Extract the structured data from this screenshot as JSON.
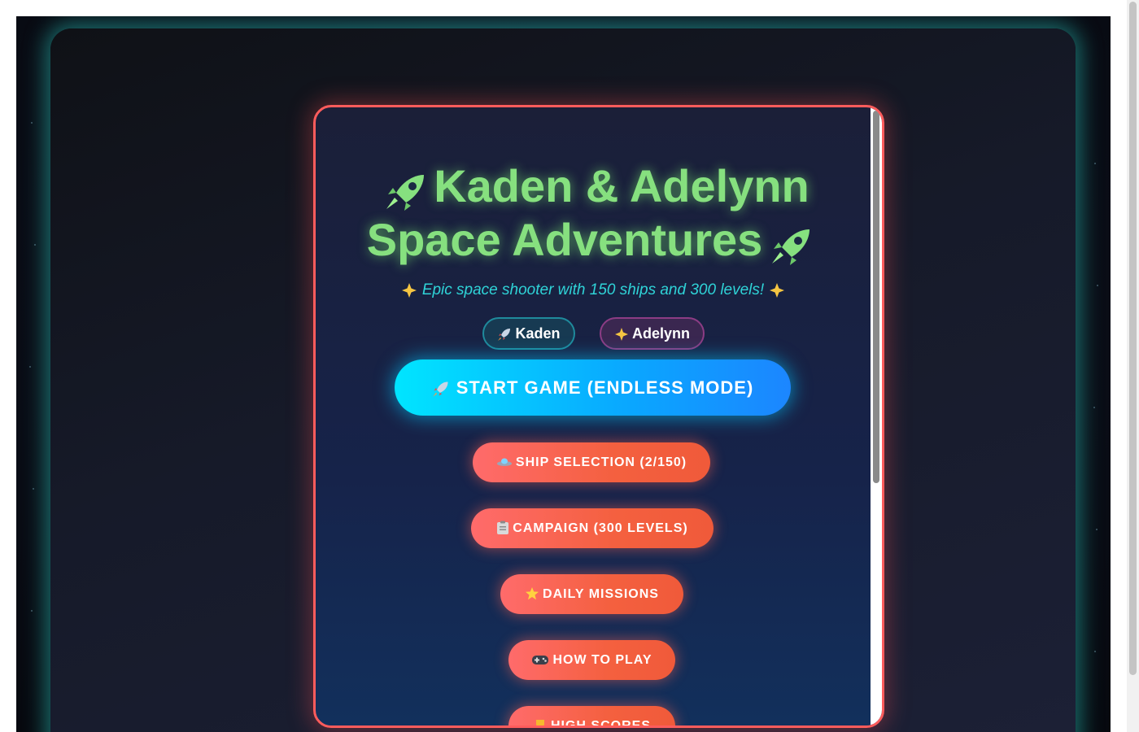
{
  "menu": {
    "title_line1": "Kaden & Adelynn",
    "title_line2": "Space Adventures",
    "subtitle": "Epic space shooter with 150 ships and 300 levels!",
    "players": [
      {
        "label": "Kaden",
        "icon": "rocket-icon"
      },
      {
        "label": "Adelynn",
        "icon": "sparkle-star-icon"
      }
    ],
    "start_button": "START GAME (ENDLESS MODE)",
    "buttons": [
      {
        "label": "SHIP SELECTION (2/150)",
        "icon": "ufo-icon"
      },
      {
        "label": "CAMPAIGN (300 LEVELS)",
        "icon": "clipboard-icon"
      },
      {
        "label": "DAILY MISSIONS",
        "icon": "star-icon"
      },
      {
        "label": "HOW TO PLAY",
        "icon": "gamepad-icon"
      },
      {
        "label": "HIGH SCORES",
        "icon": "trophy-icon"
      }
    ]
  },
  "colors": {
    "title": "#86e07f",
    "subtitle": "#2fd3d7",
    "panel_border": "#ff5c5c",
    "start_button": "#0aa6ff",
    "menu_button": "#f4603f",
    "container_glow": "#28beb4"
  }
}
